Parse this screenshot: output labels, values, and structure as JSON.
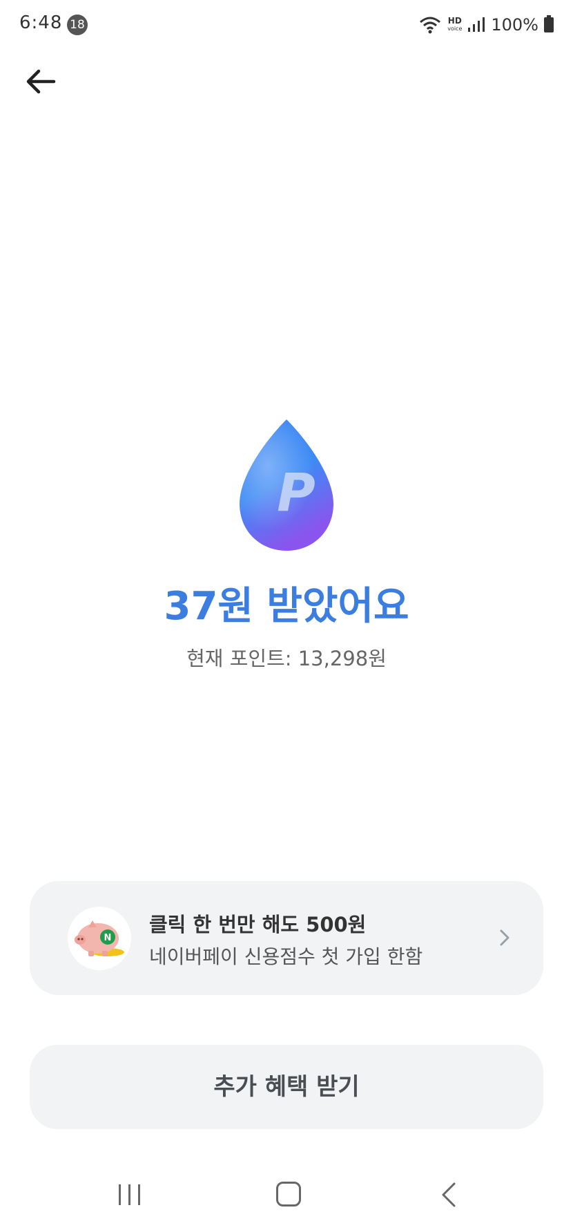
{
  "status_bar": {
    "time": "6:48",
    "notification_count": "18",
    "hd_label": "HD",
    "hd_sub": "voice",
    "battery": "100%",
    "icons": [
      "wifi-icon",
      "hd-voice-icon",
      "signal-icon",
      "battery-icon"
    ]
  },
  "header": {
    "back_icon": "arrow-left-icon"
  },
  "reward": {
    "icon": "point-drop-icon",
    "icon_letter": "P",
    "headline": "37원 받았어요",
    "current_points": "현재 포인트: 13,298원"
  },
  "promo": {
    "title": "클릭 한 번만 해도 500원",
    "subtitle": "네이버페이 신용점수 첫 가입 한함",
    "thumb_icon": "piggy-bank-icon",
    "thumb_letter": "N",
    "chevron_icon": "chevron-right-icon"
  },
  "cta": {
    "label": "추가 혜택 받기"
  },
  "nav_bar": {
    "icons": [
      "recents-icon",
      "home-icon",
      "back-icon"
    ]
  },
  "colors": {
    "accent": "#3b7ee0",
    "card_bg": "#f2f3f5",
    "text_muted": "#666666"
  }
}
